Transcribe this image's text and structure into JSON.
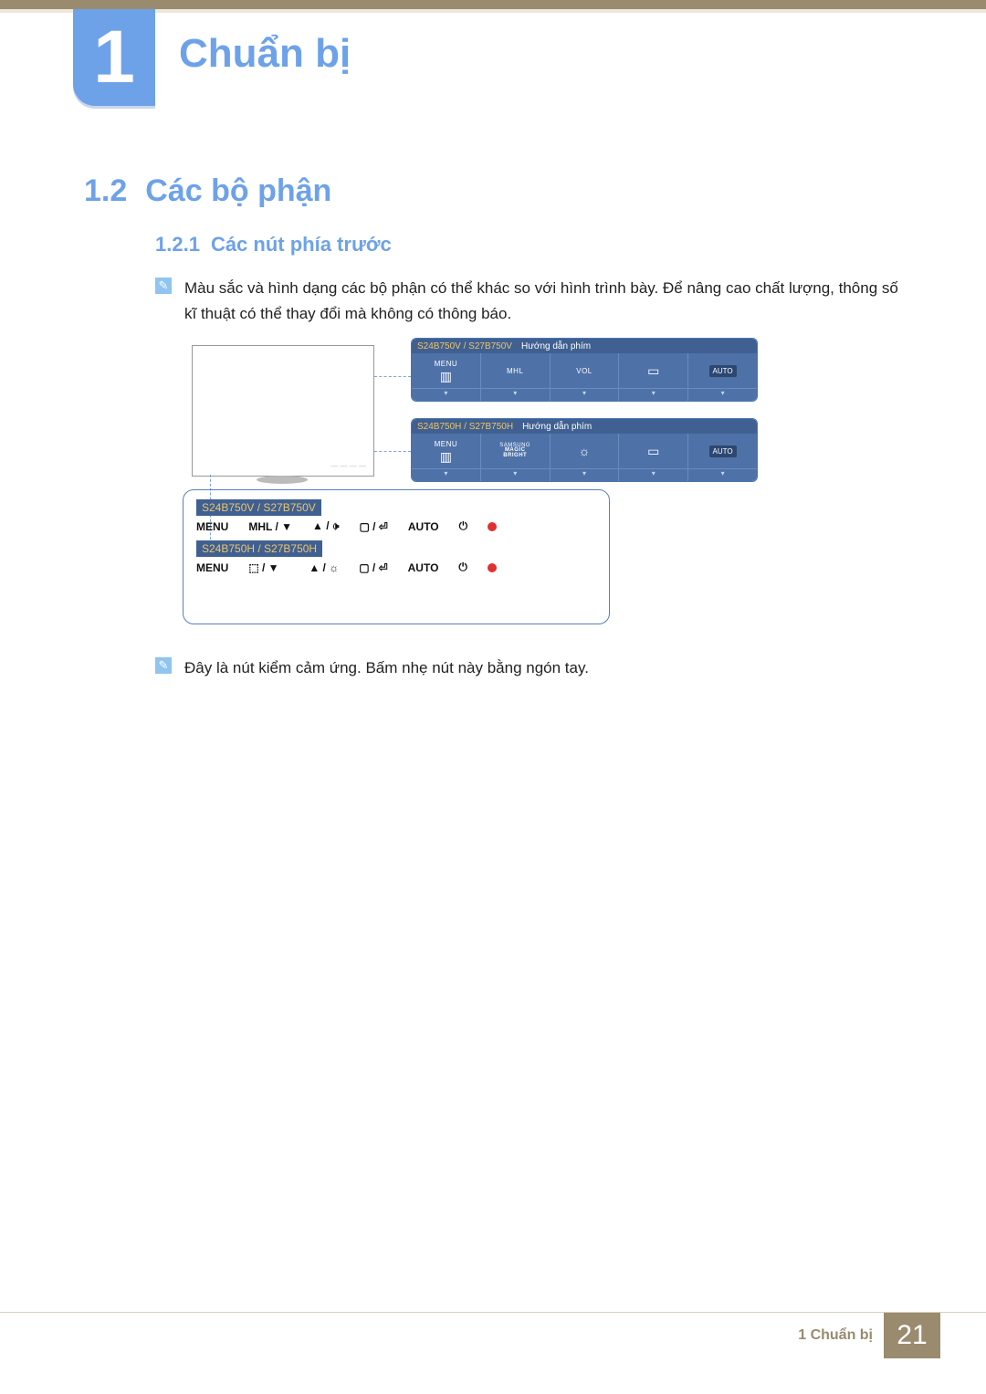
{
  "chapter": {
    "number": "1",
    "title": "Chuẩn bị"
  },
  "section": {
    "number": "1.2",
    "title": "Các bộ phận"
  },
  "subsection": {
    "number": "1.2.1",
    "title": "Các nút phía trước"
  },
  "note1": "Màu sắc và hình dạng các bộ phận có thể khác so với hình trình bày. Để nâng cao chất lượng, thông số kĩ thuật có thể thay đổi mà không có thông báo.",
  "note2": "Đây là nút kiểm cảm ứng. Bấm nhẹ nút này bằng ngón tay.",
  "osd1": {
    "model": "S24B750V / S27B750V",
    "guide": "Hướng dẫn phím",
    "cells": [
      {
        "label": "MENU",
        "icon": "▥"
      },
      {
        "label": "MHL"
      },
      {
        "label": "VOL"
      },
      {
        "icon": "▭"
      },
      {
        "auto": "AUTO"
      }
    ]
  },
  "osd2": {
    "model": "S24B750H / S27B750H",
    "guide": "Hướng dẫn phím",
    "cells": [
      {
        "label": "MENU",
        "icon": "▥"
      },
      {
        "magic_top": "SAMSUNG",
        "magic_mid": "MAGIC",
        "magic_bot": "BRIGHT"
      },
      {
        "icon": "☼"
      },
      {
        "icon": "▭"
      },
      {
        "auto": "AUTO"
      }
    ]
  },
  "panel1": {
    "model": "S24B750V / S27B750V",
    "buttons": [
      "MENU",
      "MHL / ▼",
      "▲ / 🕩",
      "▢ / ⏎",
      "AUTO",
      "⏻"
    ]
  },
  "panel2": {
    "model": "S24B750H / S27B750H",
    "buttons": [
      "MENU",
      "⬚ / ▼",
      "▲ / ☼",
      "▢ / ⏎",
      "AUTO",
      "⏻"
    ]
  },
  "footer": {
    "label": "1 Chuẩn bị",
    "page": "21"
  }
}
